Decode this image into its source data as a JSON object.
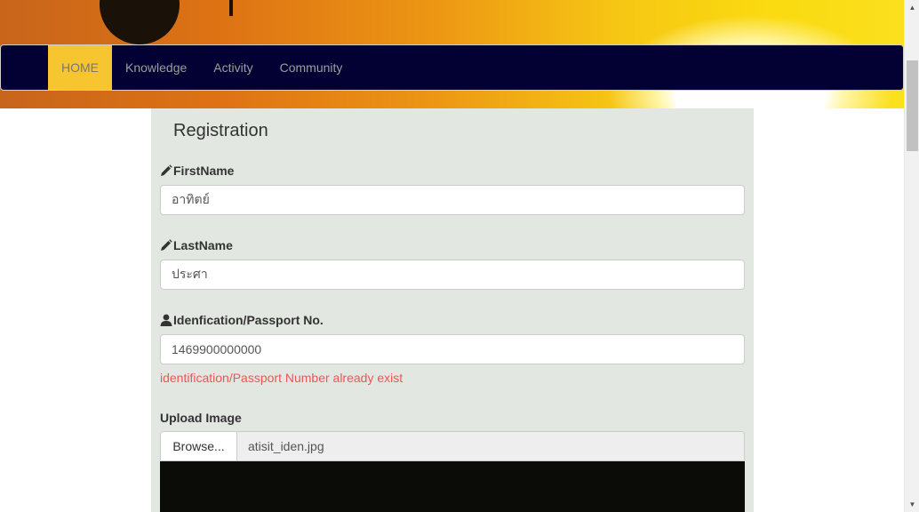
{
  "nav": {
    "items": [
      {
        "label": "HOME",
        "active": true
      },
      {
        "label": "Knowledge",
        "active": false
      },
      {
        "label": "Activity",
        "active": false
      },
      {
        "label": "Community",
        "active": false
      }
    ]
  },
  "form": {
    "title": "Registration",
    "firstname": {
      "label": "FirstName",
      "value": "อาทิตย์",
      "icon": "pencil-icon"
    },
    "lastname": {
      "label": "LastName",
      "value": "ประศา",
      "icon": "pencil-icon"
    },
    "idnumber": {
      "label": "Idenfication/Passport No.",
      "value": "1469900000000",
      "icon": "user-icon"
    },
    "id_error": "identification/Passport Number already exist",
    "upload": {
      "label": "Upload Image",
      "browse_label": "Browse...",
      "file_name": "atisit_iden.jpg"
    }
  },
  "colors": {
    "navbar_bg": "#030033",
    "nav_active_bg": "#f7c52f",
    "panel_bg": "#e3e7e2",
    "error": "#f05454"
  }
}
